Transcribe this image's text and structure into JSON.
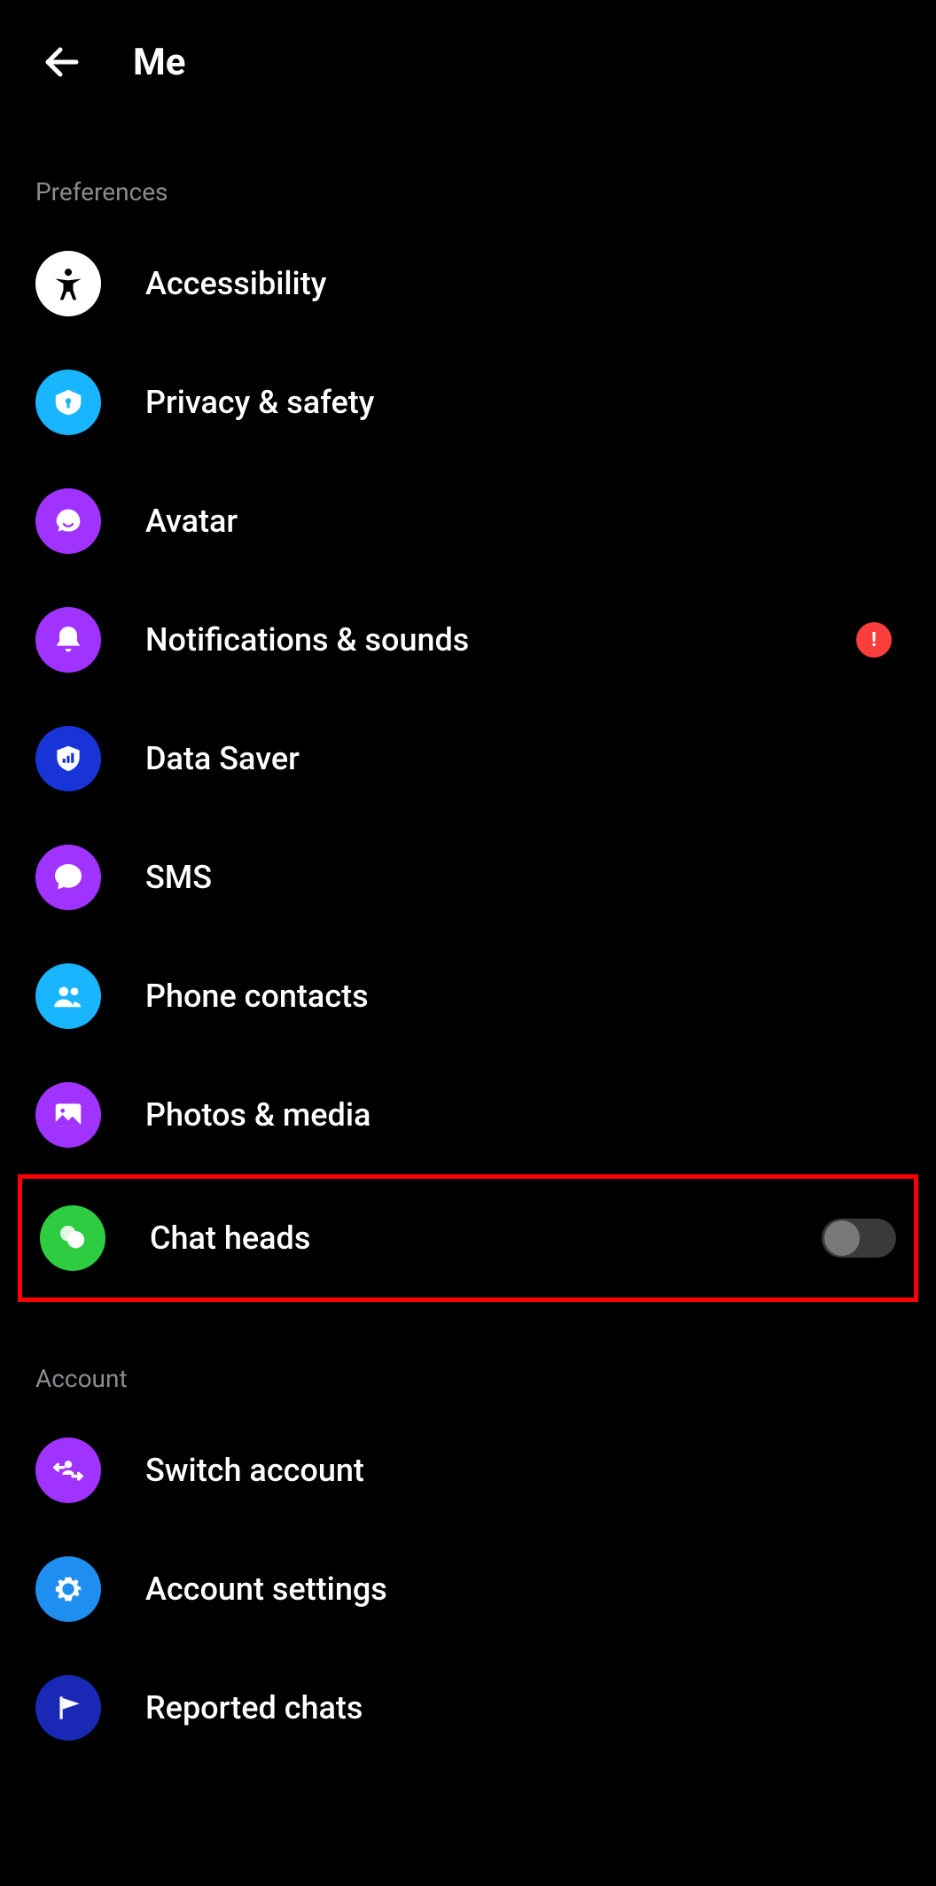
{
  "header": {
    "title": "Me"
  },
  "sections": {
    "preferences": {
      "title": "Preferences",
      "items": {
        "accessibility": {
          "label": "Accessibility"
        },
        "privacy": {
          "label": "Privacy & safety"
        },
        "avatar": {
          "label": "Avatar"
        },
        "notifications": {
          "label": "Notifications & sounds",
          "alert": "!"
        },
        "data_saver": {
          "label": "Data Saver"
        },
        "sms": {
          "label": "SMS"
        },
        "phone_contacts": {
          "label": "Phone contacts"
        },
        "photos_media": {
          "label": "Photos & media"
        },
        "chat_heads": {
          "label": "Chat heads",
          "toggle": false,
          "highlighted": true
        }
      }
    },
    "account": {
      "title": "Account",
      "items": {
        "switch_account": {
          "label": "Switch account"
        },
        "account_settings": {
          "label": "Account settings"
        },
        "reported_chats": {
          "label": "Reported chats"
        }
      }
    }
  }
}
